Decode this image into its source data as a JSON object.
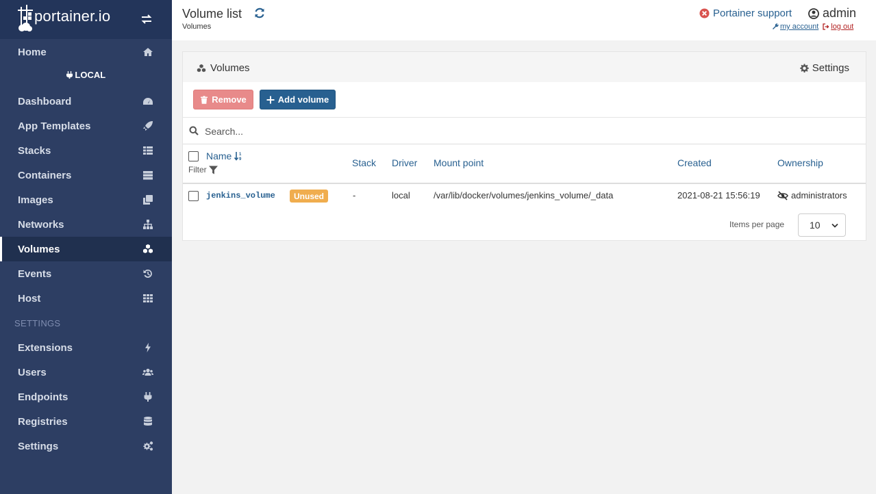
{
  "brand": {
    "name": "portainer.io"
  },
  "sidebar": {
    "home": "Home",
    "endpoint": "LOCAL",
    "items": [
      {
        "label": "Dashboard"
      },
      {
        "label": "App Templates"
      },
      {
        "label": "Stacks"
      },
      {
        "label": "Containers"
      },
      {
        "label": "Images"
      },
      {
        "label": "Networks"
      },
      {
        "label": "Volumes"
      },
      {
        "label": "Events"
      },
      {
        "label": "Host"
      }
    ],
    "settings_title": "SETTINGS",
    "settings_items": [
      {
        "label": "Extensions"
      },
      {
        "label": "Users"
      },
      {
        "label": "Endpoints"
      },
      {
        "label": "Registries"
      },
      {
        "label": "Settings"
      }
    ]
  },
  "header": {
    "title": "Volume list",
    "breadcrumb": "Volumes",
    "support": "Portainer support",
    "user": "admin",
    "my_account": "my account",
    "log_out": "log out"
  },
  "widget": {
    "title": "Volumes",
    "settings": "Settings",
    "remove_label": "Remove",
    "add_label": "Add volume",
    "search_placeholder": "Search...",
    "columns": {
      "name": "Name",
      "filter": "Filter",
      "stack": "Stack",
      "driver": "Driver",
      "mount": "Mount point",
      "created": "Created",
      "ownership": "Ownership"
    },
    "rows": [
      {
        "name": "jenkins_volume",
        "badge": "Unused",
        "stack": "-",
        "driver": "local",
        "mount": "/var/lib/docker/volumes/jenkins_volume/_data",
        "created": "2021-08-21 15:56:19",
        "ownership": "administrators"
      }
    ],
    "items_per_page_label": "Items per page",
    "items_per_page": "10"
  }
}
